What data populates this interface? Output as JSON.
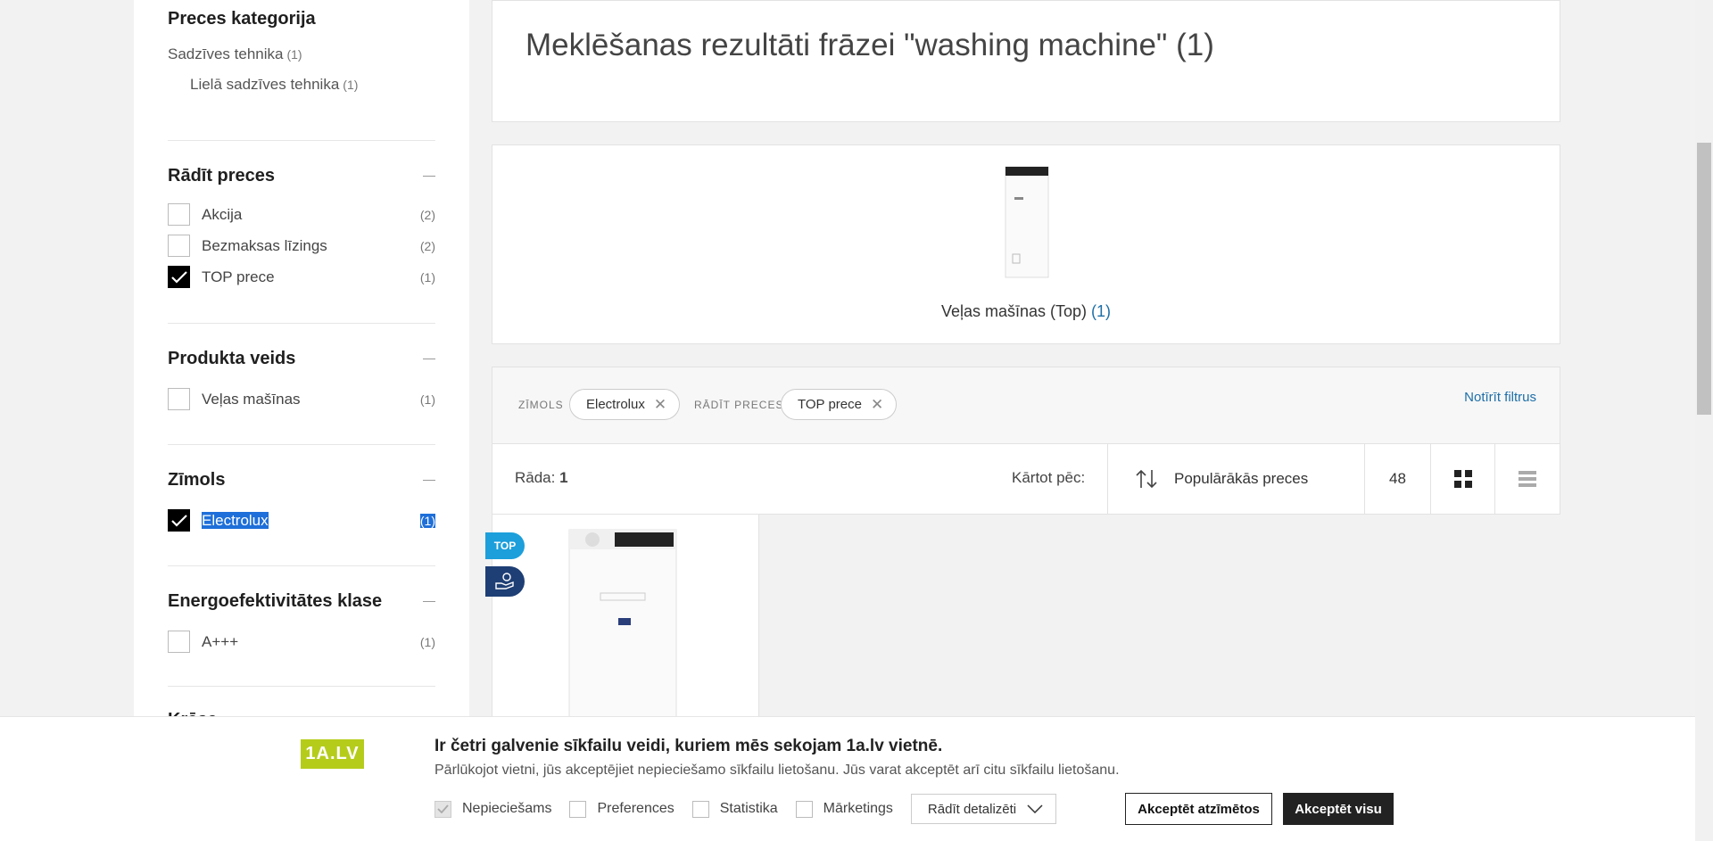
{
  "sidebar": {
    "category_title": "Preces kategorija",
    "categories": [
      {
        "label": "Sadzīves tehnika",
        "count": "(1)"
      },
      {
        "label": "Lielā sadzīves tehnika",
        "count": "(1)"
      }
    ],
    "show_products": {
      "title": "Rādīt preces",
      "options": [
        {
          "label": "Akcija",
          "count": "(2)",
          "checked": false
        },
        {
          "label": "Bezmaksas līzings",
          "count": "(2)",
          "checked": false
        },
        {
          "label": "TOP prece",
          "count": "(1)",
          "checked": true
        }
      ]
    },
    "product_type": {
      "title": "Produkta veids",
      "options": [
        {
          "label": "Veļas mašīnas",
          "count": "(1)",
          "checked": false
        }
      ]
    },
    "brand": {
      "title": "Zīmols",
      "options": [
        {
          "label": "Electrolux",
          "count": "(1)",
          "checked": true
        }
      ]
    },
    "energy": {
      "title": "Energoefektivitātes klase",
      "options": [
        {
          "label": "A+++",
          "count": "(1)",
          "checked": false
        }
      ]
    },
    "color_title": "Krāsa"
  },
  "main": {
    "search_title": "Meklēšanas rezultāti frāzei \"washing machine\" (1)",
    "category_card": {
      "label": "Veļas mašīnas (Top)",
      "count": "(1)"
    },
    "filters": {
      "brand_label": "ZĪMOLS",
      "brand_chip": "Electrolux",
      "show_label": "RĀDĪT PRECES",
      "show_chip": "TOP prece",
      "clear_link": "Notīrīt filtrus"
    },
    "toolbar": {
      "showing_label": "Rāda:",
      "showing_count": "1",
      "sort_label": "Kārtot pēc:",
      "sort_value": "Populārākās preces",
      "per_page": "48"
    },
    "product": {
      "badge_top": "TOP"
    }
  },
  "cookie": {
    "logo": "1A.LV",
    "title": "Ir četri galvenie sīkfailu veidi, kuriem mēs sekojam 1a.lv vietnē.",
    "text": "Pārlūkojot vietni, jūs akceptējiet nepieciešamo sīkfailu lietošanu. Jūs varat akceptēt arī citu sīkfailu lietošanu.",
    "options": [
      "Nepieciešams",
      "Preferences",
      "Statistika",
      "Mārketings"
    ],
    "details_button": "Rādīt detalizēti",
    "accept_selected": "Akceptēt atzīmētos",
    "accept_all": "Akceptēt visu"
  },
  "colors": {
    "accent_blue": "#1e6fa8",
    "top_badge": "#1c9fdb",
    "lease_badge": "#1e3f75",
    "logo_green": "#b5cc1b"
  }
}
